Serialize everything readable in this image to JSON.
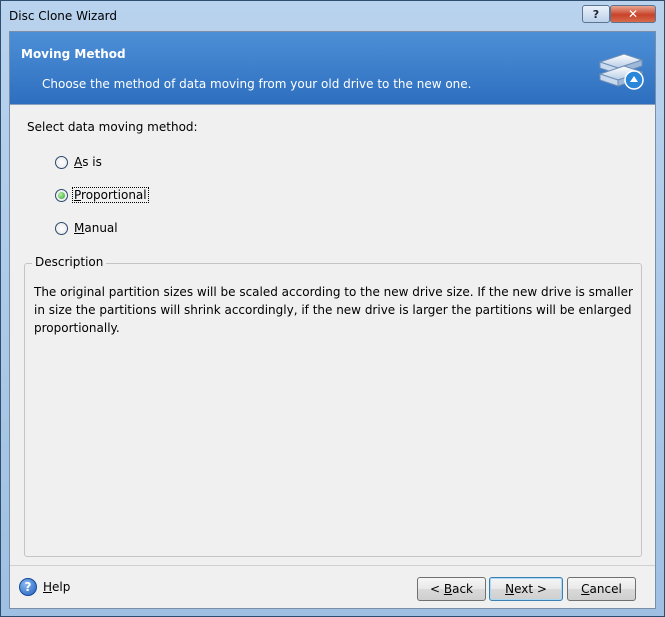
{
  "window": {
    "title": "Disc Clone Wizard",
    "help_button": "?",
    "close_button": "✕"
  },
  "header": {
    "title": "Moving Method",
    "subtitle": "Choose the method of data moving from your old drive to the new one."
  },
  "main": {
    "select_label": "Select data moving method:",
    "options": [
      {
        "label": "As is",
        "accel": "A",
        "rest": "s is",
        "checked": false
      },
      {
        "label": "Proportional",
        "accel": "P",
        "rest": "roportional",
        "checked": true
      },
      {
        "label": "Manual",
        "accel": "M",
        "rest": "anual",
        "checked": false
      }
    ],
    "description": {
      "legend": "Description",
      "text": "The original partition sizes will be scaled according to the new drive size. If the new drive is smaller in size the partitions will shrink accordingly, if the new drive is larger the partitions will be enlarged proportionally."
    }
  },
  "footer": {
    "help": {
      "accel": "H",
      "rest": "elp"
    },
    "back": {
      "prefix": "< ",
      "accel": "B",
      "rest": "ack"
    },
    "next": {
      "accel": "N",
      "rest": "ext >"
    },
    "cancel": {
      "accel": "C",
      "rest": "ancel"
    }
  },
  "colors": {
    "header_bg": "#3a7cc9",
    "radio_checked": "#2ea22b",
    "window_frame": "#a9c6e8"
  }
}
